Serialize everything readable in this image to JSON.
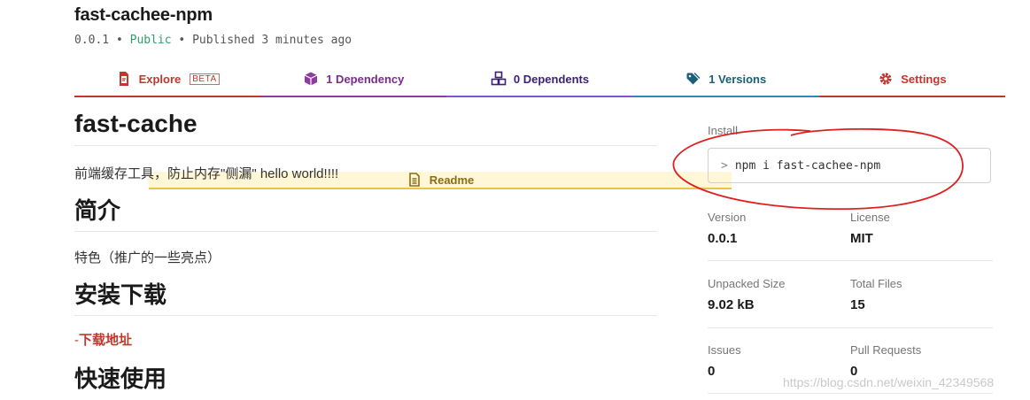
{
  "package": {
    "name": "fast-cachee-npm",
    "version": "0.0.1",
    "separator": "•",
    "visibility": "Public",
    "published": "Published 3 minutes ago"
  },
  "tabs": [
    {
      "key": "readme",
      "label": "Readme",
      "icon": "readme-icon"
    },
    {
      "key": "explore",
      "label": "Explore",
      "badge": "BETA",
      "icon": "explore-icon"
    },
    {
      "key": "deps",
      "label": "1 Dependency",
      "icon": "box-icon"
    },
    {
      "key": "dependents",
      "label": "0 Dependents",
      "icon": "boxes-icon"
    },
    {
      "key": "versions",
      "label": "1 Versions",
      "icon": "tag-icon"
    },
    {
      "key": "settings",
      "label": "Settings",
      "icon": "gear-icon"
    }
  ],
  "readme": {
    "h1": "fast-cache",
    "intro": "前端缓存工具，防止内存\"侧漏\" hello world!!!!",
    "h2_intro": "简介",
    "features": "特色（推广的一些亮点）",
    "h2_install": "安装下载",
    "link_prefix": "-",
    "download_link": "下载地址",
    "h2_usage": "快速使用"
  },
  "sidebar": {
    "install_label": "Install",
    "prompt": ">",
    "install_cmd": "npm i fast-cachee-npm",
    "version_label": "Version",
    "version_value": "0.0.1",
    "license_label": "License",
    "license_value": "MIT",
    "unpacked_label": "Unpacked Size",
    "unpacked_value": "9.02 kB",
    "files_label": "Total Files",
    "files_value": "15",
    "issues_label": "Issues",
    "issues_value": "0",
    "prs_label": "Pull Requests",
    "prs_value": "0"
  },
  "watermark": "https://blog.csdn.net/weixin_42349568",
  "colors": {
    "readme_tab_bg": "#fff7d6",
    "readme_tab_accent": "#e9c34b",
    "npm_red": "#c2362d",
    "public_green": "#2f9e6a",
    "annotation_red": "#e02020"
  }
}
